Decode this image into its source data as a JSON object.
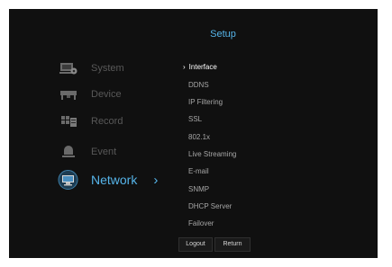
{
  "header": {
    "title": "Setup"
  },
  "sidebar": {
    "items": [
      {
        "label": "System",
        "icon": "system-icon"
      },
      {
        "label": "Device",
        "icon": "device-icon"
      },
      {
        "label": "Record",
        "icon": "record-icon"
      },
      {
        "label": "Event",
        "icon": "event-icon"
      },
      {
        "label": "Network",
        "icon": "network-icon",
        "selected": true
      }
    ]
  },
  "submenu": {
    "items": [
      {
        "label": "Interface",
        "selected": true
      },
      {
        "label": "DDNS"
      },
      {
        "label": "IP Filtering"
      },
      {
        "label": "SSL"
      },
      {
        "label": "802.1x"
      },
      {
        "label": "Live Streaming"
      },
      {
        "label": "E-mail"
      },
      {
        "label": "SNMP"
      },
      {
        "label": "DHCP Server"
      },
      {
        "label": "Failover"
      }
    ]
  },
  "footer": {
    "logout_label": "Logout",
    "return_label": "Return"
  },
  "colors": {
    "background": "#101010",
    "accent": "#56b4e9",
    "inactive_text": "#585858",
    "menu_text": "#a6a6a6",
    "selected_text": "#ffffff"
  }
}
